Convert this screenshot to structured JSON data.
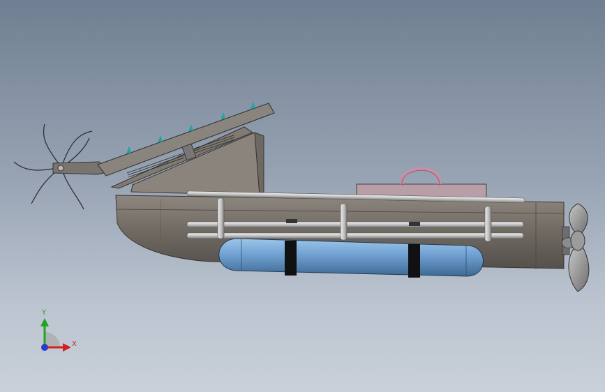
{
  "viewport": {
    "background_top": "#6f7f91",
    "background_bottom": "#c9d0d9"
  },
  "model": {
    "parts": [
      "boat-hull",
      "cutter-rake",
      "inclined-conveyor",
      "support-frame",
      "handrail",
      "float-tank",
      "tank-strap",
      "cabin-box",
      "lifting-ring",
      "propeller"
    ],
    "colors": {
      "hull": "#7d7670",
      "conveyor": "#8a847e",
      "tank": "#6f9fd0",
      "cabin": "#b89ea6",
      "ring": "#c890a8",
      "rail": "#d6d6d6",
      "strap": "#111111",
      "blade_tips": "#1fa6a6"
    }
  },
  "triad": {
    "y_label": "Y",
    "x_label": "X",
    "y_color": "#1fa51f",
    "x_color": "#d12020",
    "z_color": "#2a3cc8"
  }
}
